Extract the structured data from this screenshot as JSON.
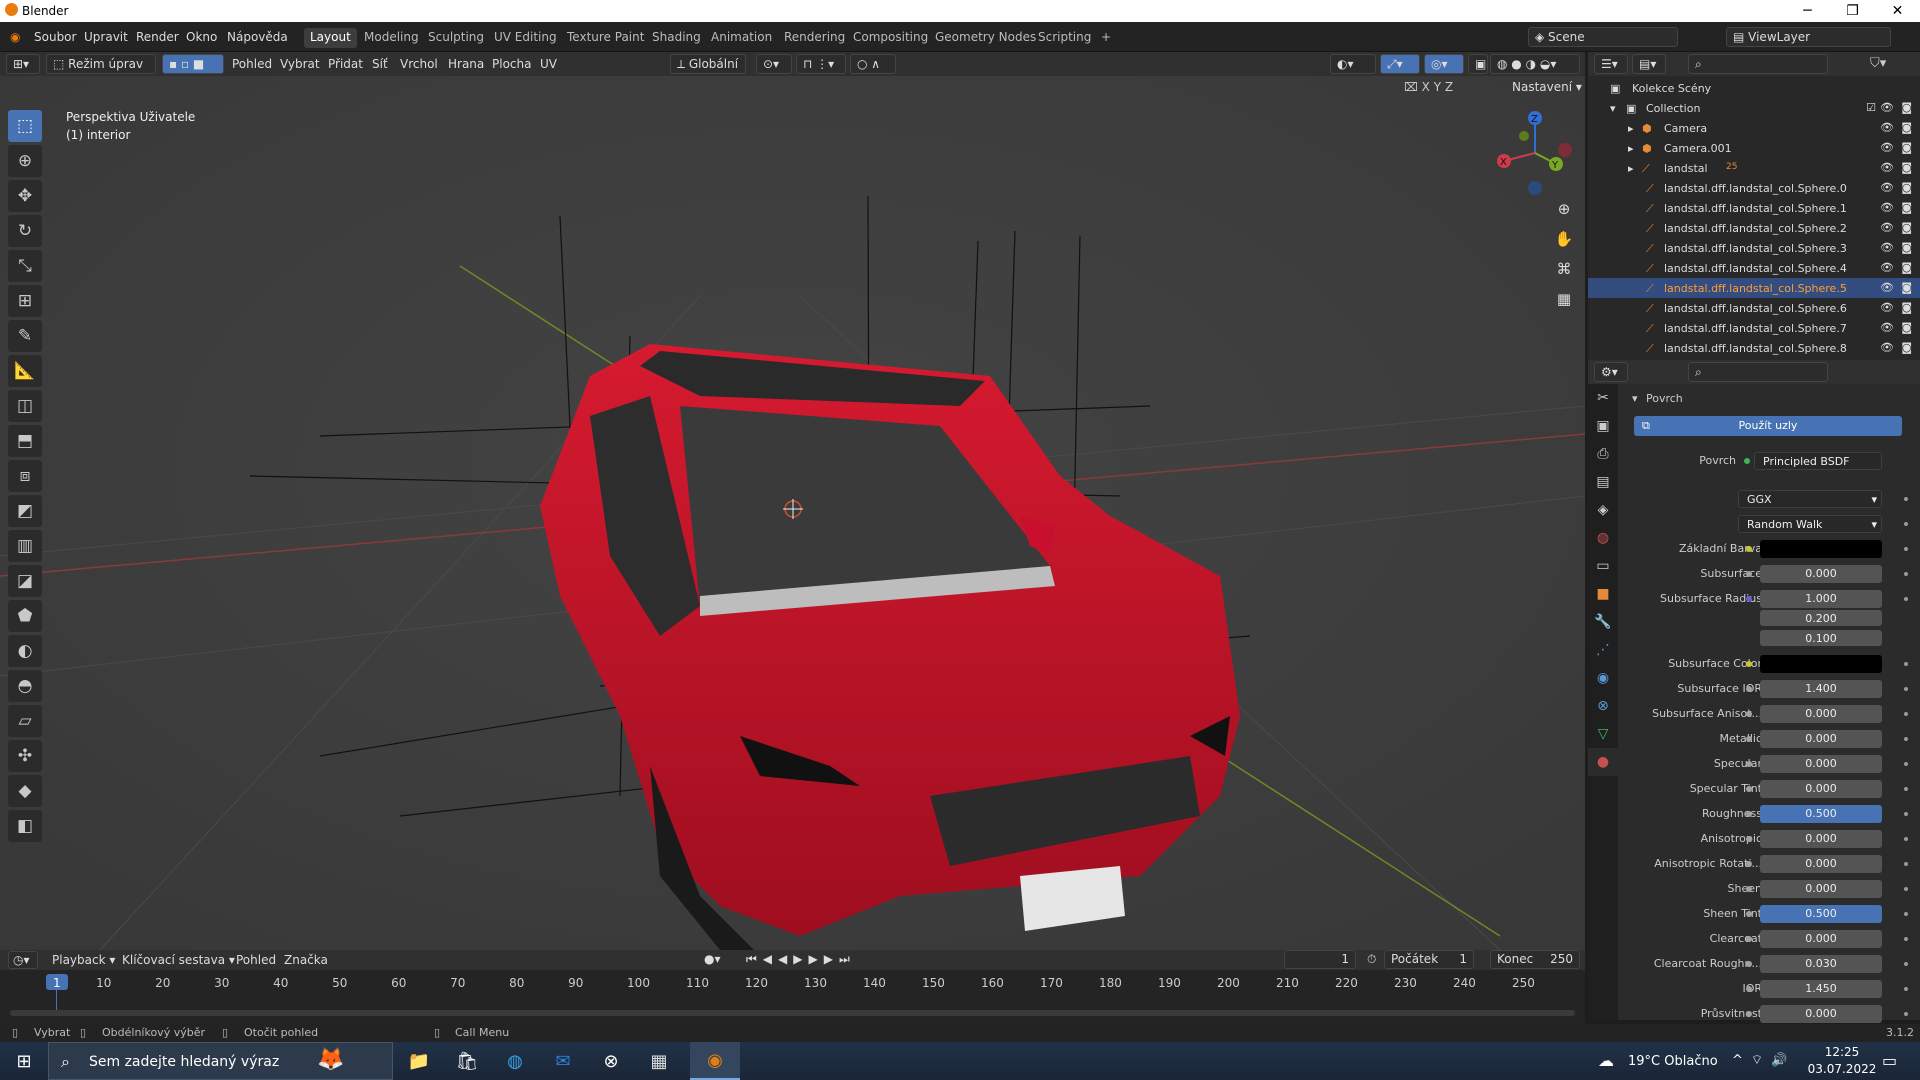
{
  "window": {
    "title": "Blender"
  },
  "menu": [
    "Soubor",
    "Upravit",
    "Render",
    "Okno",
    "Nápověda"
  ],
  "workspaces": [
    "Layout",
    "Modeling",
    "Sculpting",
    "UV Editing",
    "Texture Paint",
    "Shading",
    "Animation",
    "Rendering",
    "Compositing",
    "Geometry Nodes",
    "Scripting",
    "+"
  ],
  "scene": {
    "name": "Scene",
    "viewlayer": "ViewLayer"
  },
  "viewport_header": {
    "mode": "Režim úprav",
    "menus": [
      "Pohled",
      "Vybrat",
      "Přidat",
      "Síť",
      "Vrchol",
      "Hrana",
      "Plocha",
      "UV"
    ],
    "transform": "Globální",
    "axes": [
      "X",
      "Y",
      "Z"
    ],
    "options": "Nastavení"
  },
  "viewport": {
    "view_name": "Perspektiva Uživatele",
    "object": "(1) interior"
  },
  "gizmo": {
    "x": "X",
    "y": "Y",
    "z": "Z"
  },
  "outliner": {
    "root": "Kolekce Scény",
    "collection": "Collection",
    "items": [
      {
        "name": "Camera",
        "selected": false
      },
      {
        "name": "Camera.001",
        "selected": false
      },
      {
        "name": "landstal",
        "selected": false
      },
      {
        "name": "landstal.dff.landstal_col.Sphere.0",
        "selected": false
      },
      {
        "name": "landstal.dff.landstal_col.Sphere.1",
        "selected": false
      },
      {
        "name": "landstal.dff.landstal_col.Sphere.2",
        "selected": false
      },
      {
        "name": "landstal.dff.landstal_col.Sphere.3",
        "selected": false
      },
      {
        "name": "landstal.dff.landstal_col.Sphere.4",
        "selected": false
      },
      {
        "name": "landstal.dff.landstal_col.Sphere.5",
        "selected": true
      },
      {
        "name": "landstal.dff.landstal_col.Sphere.6",
        "selected": false
      },
      {
        "name": "landstal.dff.landstal_col.Sphere.7",
        "selected": false
      },
      {
        "name": "landstal.dff.landstal_col.Sphere.8",
        "selected": false
      }
    ],
    "badge": "25"
  },
  "properties": {
    "panel": "Povrch",
    "use_nodes": "Použít uzly",
    "surface_label": "Povrch",
    "surface_value": "Principled BSDF",
    "distribution": "GGX",
    "subsurface_method": "Random Walk",
    "rows": [
      {
        "label": "Základní Barva",
        "value": "",
        "kind": "color",
        "dot": "y"
      },
      {
        "label": "Subsurface",
        "value": "0.000",
        "kind": "num",
        "dot": ""
      },
      {
        "label": "Subsurface Radius",
        "value": "1.000",
        "kind": "num",
        "dot": "p"
      },
      {
        "label": "",
        "value": "0.200",
        "kind": "num",
        "dot": "none"
      },
      {
        "label": "",
        "value": "0.100",
        "kind": "num",
        "dot": "none"
      },
      {
        "label": "Subsurface Color",
        "value": "",
        "kind": "color",
        "dot": "y"
      },
      {
        "label": "Subsurface IOR",
        "value": "1.400",
        "kind": "num",
        "dot": ""
      },
      {
        "label": "Subsurface Anisot...",
        "value": "0.000",
        "kind": "num",
        "dot": ""
      },
      {
        "label": "Metallic",
        "value": "0.000",
        "kind": "num",
        "dot": ""
      },
      {
        "label": "Specular",
        "value": "0.000",
        "kind": "num",
        "dot": ""
      },
      {
        "label": "Specular Tint",
        "value": "0.000",
        "kind": "num",
        "dot": ""
      },
      {
        "label": "Roughness",
        "value": "0.500",
        "kind": "blue",
        "dot": ""
      },
      {
        "label": "Anisotropic",
        "value": "0.000",
        "kind": "num",
        "dot": ""
      },
      {
        "label": "Anisotropic Rotati...",
        "value": "0.000",
        "kind": "num",
        "dot": ""
      },
      {
        "label": "Sheen",
        "value": "0.000",
        "kind": "num",
        "dot": ""
      },
      {
        "label": "Sheen Tint",
        "value": "0.500",
        "kind": "blue",
        "dot": ""
      },
      {
        "label": "Clearcoat",
        "value": "0.000",
        "kind": "num",
        "dot": ""
      },
      {
        "label": "Clearcoat Roughn...",
        "value": "0.030",
        "kind": "num",
        "dot": ""
      },
      {
        "label": "IOR",
        "value": "1.450",
        "kind": "num",
        "dot": ""
      },
      {
        "label": "Průsvitnost",
        "value": "0.000",
        "kind": "num",
        "dot": ""
      }
    ]
  },
  "timeline": {
    "menus": [
      "Playback",
      "Klíčovací sestava",
      "Pohled",
      "Značka"
    ],
    "current": "1",
    "start_label": "Počátek",
    "start": "1",
    "end_label": "Konec",
    "end": "250",
    "ticks": [
      "1",
      "10",
      "20",
      "30",
      "40",
      "50",
      "60",
      "70",
      "80",
      "90",
      "100",
      "110",
      "120",
      "130",
      "140",
      "150",
      "160",
      "170",
      "180",
      "190",
      "200",
      "210",
      "220",
      "230",
      "240",
      "250"
    ]
  },
  "statusbar": {
    "select": "Vybrat",
    "box": "Obdélníkový výběr",
    "rotate": "Otočit pohled",
    "call": "Call Menu",
    "version": "3.1.2"
  },
  "taskbar": {
    "search": "Sem zadejte hledaný výraz",
    "weather": "19°C Oblačno",
    "time": "12:25",
    "date": "03.07.2022"
  },
  "colors": {
    "accent": "#4772b3",
    "selected_text": "#ff9d3a",
    "car": "#c8102e"
  }
}
